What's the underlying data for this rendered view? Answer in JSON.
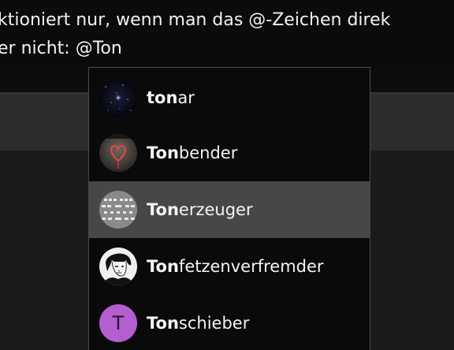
{
  "compose": {
    "line1": "ktioniert nur, wenn man das @-Zeichen direk",
    "line2": "er nicht: @Ton"
  },
  "suggestions": {
    "items": [
      {
        "match": "ton",
        "rest": "ar",
        "avatar": "starfield-avatar",
        "selected": false
      },
      {
        "match": "Ton",
        "rest": "bender",
        "avatar": "heart-avatar",
        "selected": false
      },
      {
        "match": "Ton",
        "rest": "erzeuger",
        "avatar": "pattern-avatar",
        "selected": true
      },
      {
        "match": "Ton",
        "rest": "fetzenverfremder",
        "avatar": "portrait-avatar",
        "selected": false
      },
      {
        "match": "Ton",
        "rest": "schieber",
        "avatar": "letter-avatar",
        "letter": "T",
        "selected": false
      }
    ]
  },
  "colors": {
    "selected_row": "#474747",
    "letter_avatar": "#b35fd0"
  }
}
